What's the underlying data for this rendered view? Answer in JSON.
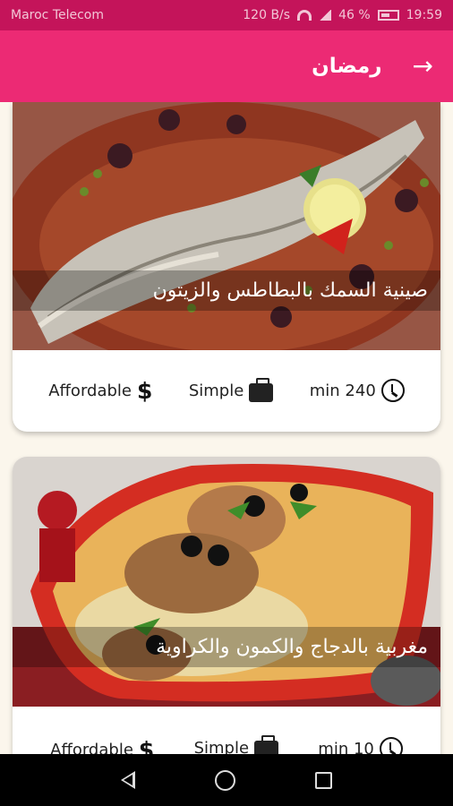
{
  "status_bar": {
    "carrier": "Maroc Telecom",
    "network_speed": "120 B/s",
    "battery": "46 %",
    "time": "19:59"
  },
  "app_bar": {
    "title": "رمضان",
    "back_icon": "arrow-forward-icon"
  },
  "recipes": [
    {
      "title": "صينية السمك بالبطاطس والزيتون",
      "duration": "min 240",
      "complexity": "Simple",
      "affordability": "Affordable"
    },
    {
      "title": "مغربية بالدجاج والكمون والكراوية",
      "duration": "min 10",
      "complexity": "Simple",
      "affordability": "Affordable"
    }
  ],
  "icons": {
    "duration": "clock-icon",
    "complexity": "briefcase-icon",
    "affordability": "dollar-icon"
  },
  "colors": {
    "app_bar": "#ec2a74",
    "status_bar": "#c4145a",
    "background": "#fbf6ec"
  }
}
